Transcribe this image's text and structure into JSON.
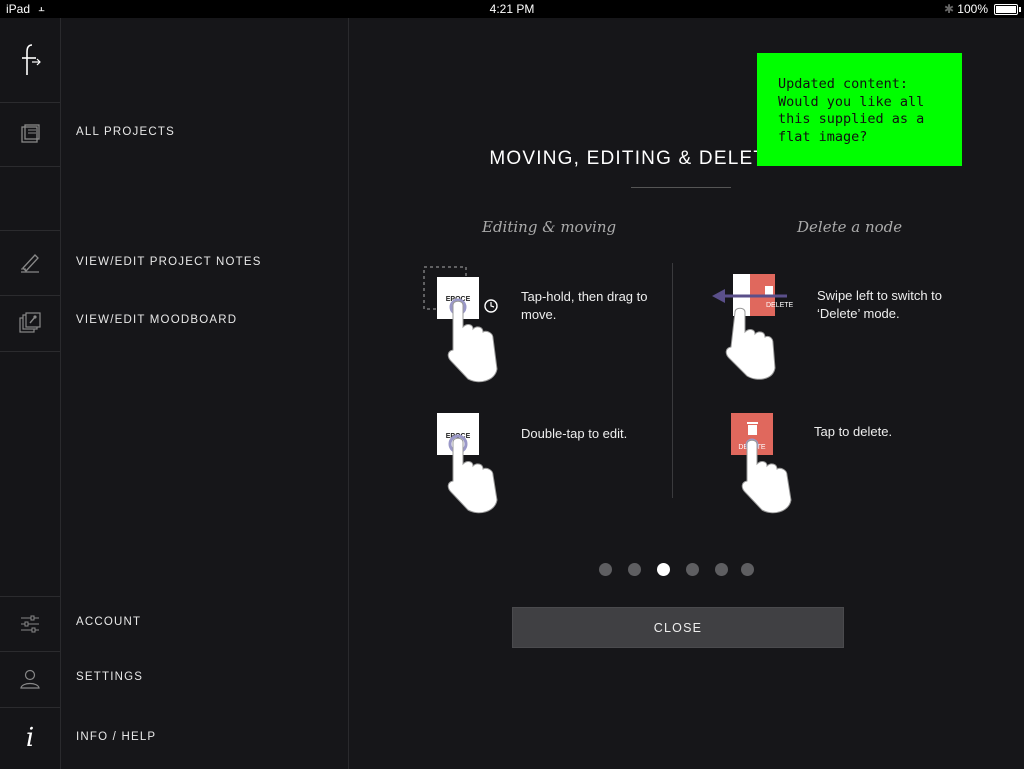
{
  "status_bar": {
    "carrier": "iPad",
    "time": "4:21 PM",
    "battery": "100%"
  },
  "menu": {
    "all_projects": "ALL PROJECTS",
    "project_notes": "VIEW/EDIT PROJECT NOTES",
    "moodboard": "VIEW/EDIT MOODBOARD",
    "account": "ACCOUNT",
    "settings": "SETTINGS",
    "info_help": "INFO / HELP"
  },
  "rail_icons": [
    "logo-icon",
    "projects-icon",
    "notes-pencil-icon",
    "moodboard-icon",
    "account-sliders-icon",
    "settings-user-icon",
    "info-icon"
  ],
  "help": {
    "title": "MOVING, EDITING & DELETING NODES",
    "left_heading": "Editing & moving",
    "right_heading": "Delete a node",
    "step_move": "Tap-hold, then drag to move.",
    "step_edit": "Double-tap to edit.",
    "step_swipe": "Swipe left to switch to ‘Delete’ mode.",
    "step_delete": "Tap to delete.",
    "node_word": "EPOCE",
    "delete_word": "DELETE",
    "close_label": "CLOSE",
    "pager": {
      "count": 6,
      "active": 3
    }
  },
  "annotation": {
    "text": "Updated content: Would you like all this supplied as a flat image?"
  },
  "colors": {
    "background": "#161619",
    "delete_red": "#e0685d",
    "note_green": "#00ff00",
    "arrow": "#5a4f8a"
  }
}
